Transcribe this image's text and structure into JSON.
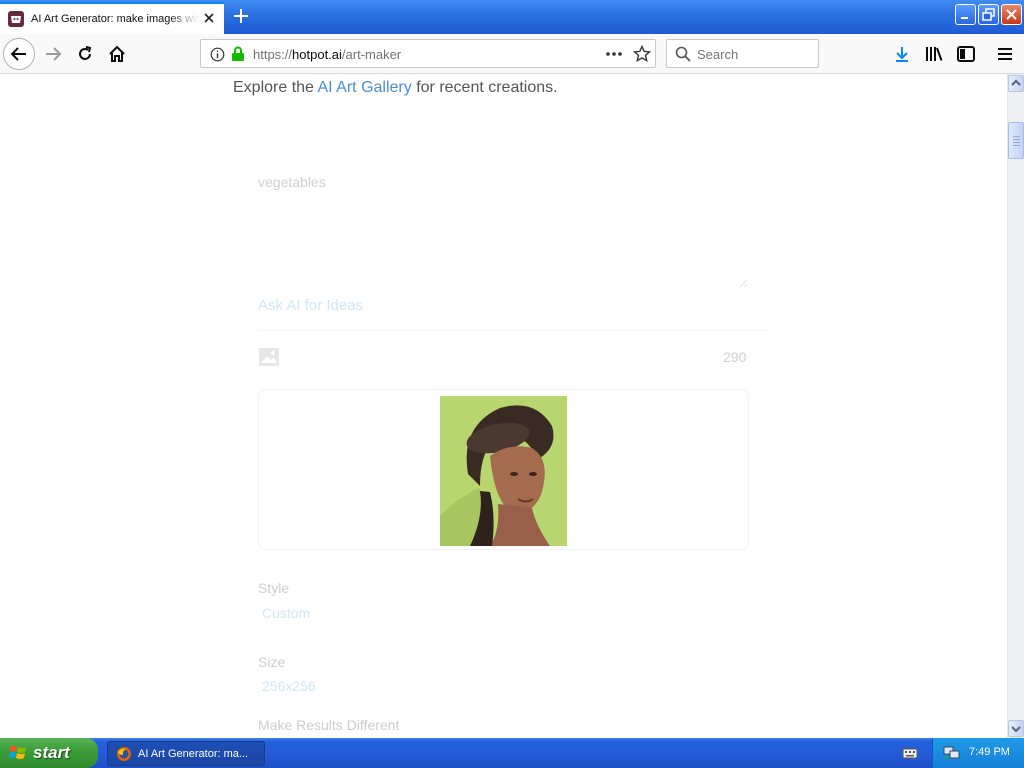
{
  "browser": {
    "tab_title": "AI Art Generator: make images with AI",
    "url_prefix": "https://",
    "url_host": "hotpot.ai",
    "url_path": "/art-maker",
    "search_placeholder": "Search"
  },
  "page": {
    "gallery_prefix": "Explore the ",
    "gallery_link": "AI Art Gallery",
    "gallery_suffix": " for recent creations.",
    "prompt_text": "vegetables",
    "ask_ai": "Ask AI for Ideas",
    "char_count": "290",
    "style_label": "Style",
    "style_value": "Custom",
    "size_label": "Size",
    "size_value": "256x256",
    "make_diff_label": "Make Results Different"
  },
  "taskbar": {
    "start": "start",
    "task_label": "AI Art Generator: ma...",
    "time": "7:49 PM"
  },
  "colors": {
    "link": "#4a8ed8",
    "taskbar": "#245ad8",
    "start_green": "#3d9e3b"
  }
}
